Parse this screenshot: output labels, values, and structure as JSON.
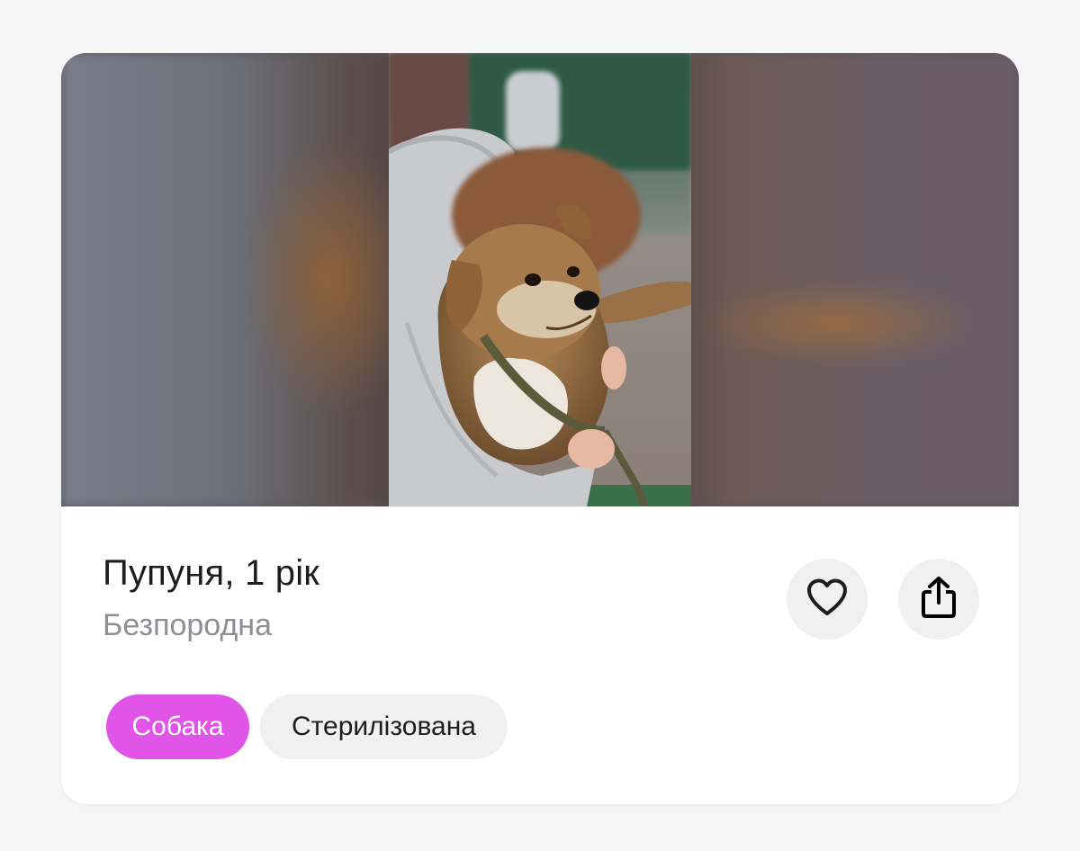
{
  "pet": {
    "title": "Пупуня, 1 рік",
    "breed": "Безпородна",
    "photo_alt": "photo"
  },
  "actions": {
    "favorite_icon": "heart-icon",
    "share_icon": "share-icon"
  },
  "tags": [
    {
      "label": "Собака",
      "color": "#e055e8"
    },
    {
      "label": "Стерилізована",
      "color": "#f0f0f0"
    }
  ]
}
